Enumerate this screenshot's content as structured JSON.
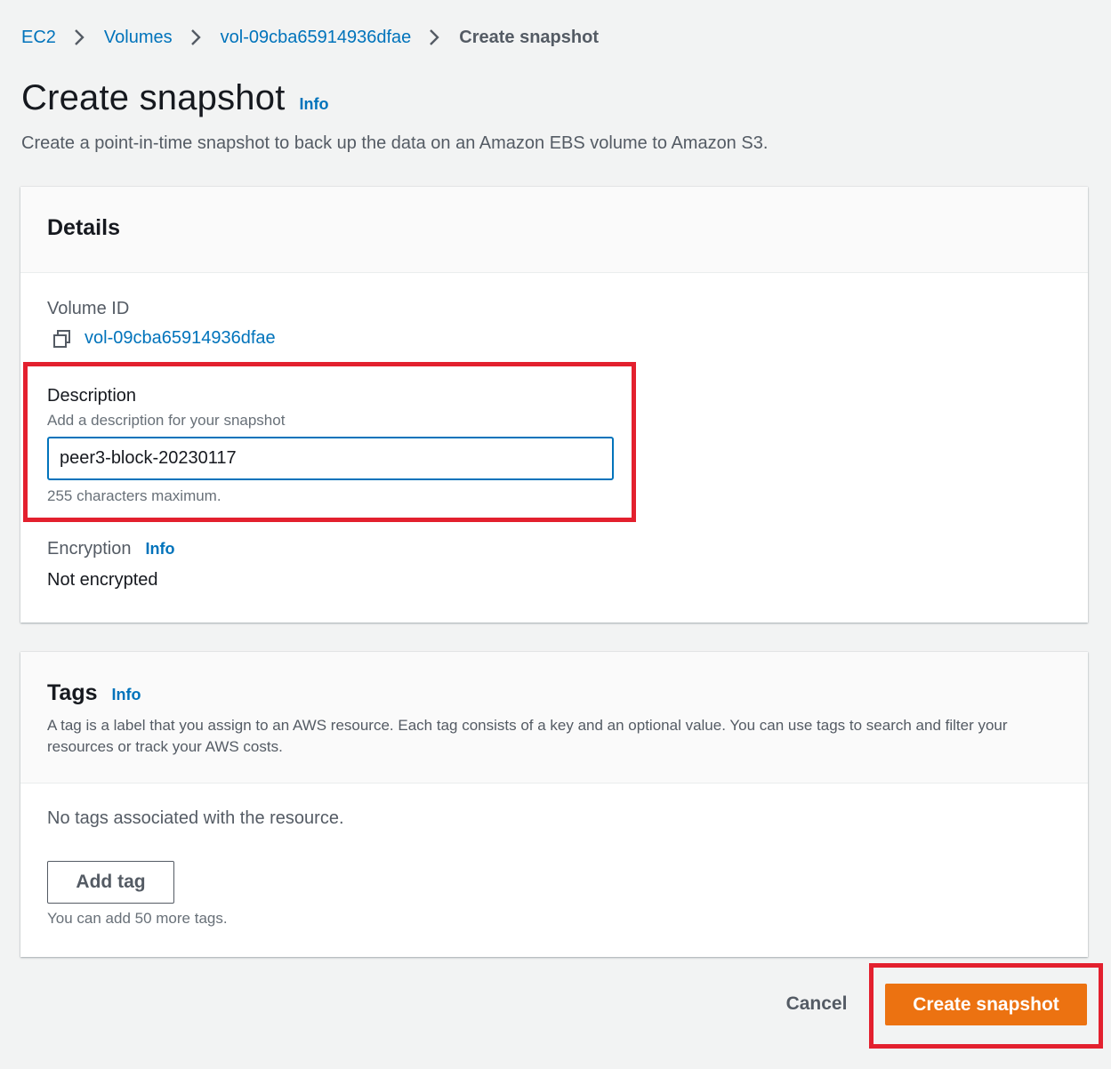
{
  "breadcrumb": {
    "items": [
      "EC2",
      "Volumes",
      "vol-09cba65914936dfae"
    ],
    "current": "Create snapshot"
  },
  "page": {
    "title": "Create snapshot",
    "info_label": "Info",
    "description": "Create a point-in-time snapshot to back up the data on an Amazon EBS volume to Amazon S3."
  },
  "details": {
    "heading": "Details",
    "volume_id_label": "Volume ID",
    "volume_id_value": "vol-09cba65914936dfae",
    "description_label": "Description",
    "description_hint": "Add a description for your snapshot",
    "description_value": "peer3-block-20230117",
    "description_constraint": "255 characters maximum.",
    "encryption_label": "Encryption",
    "encryption_info": "Info",
    "encryption_value": "Not encrypted"
  },
  "tags": {
    "heading": "Tags",
    "info_label": "Info",
    "description": "A tag is a label that you assign to an AWS resource. Each tag consists of a key and an optional value. You can use tags to search and filter your resources or track your AWS costs.",
    "empty_text": "No tags associated with the resource.",
    "add_button": "Add tag",
    "limit_text": "You can add 50 more tags."
  },
  "actions": {
    "cancel": "Cancel",
    "create": "Create snapshot"
  },
  "colors": {
    "link": "#0073bb",
    "primary_button": "#ec7211",
    "highlight": "#e3202e",
    "background": "#f2f3f3"
  },
  "icons": [
    "chevron-right-icon",
    "copy-icon"
  ]
}
